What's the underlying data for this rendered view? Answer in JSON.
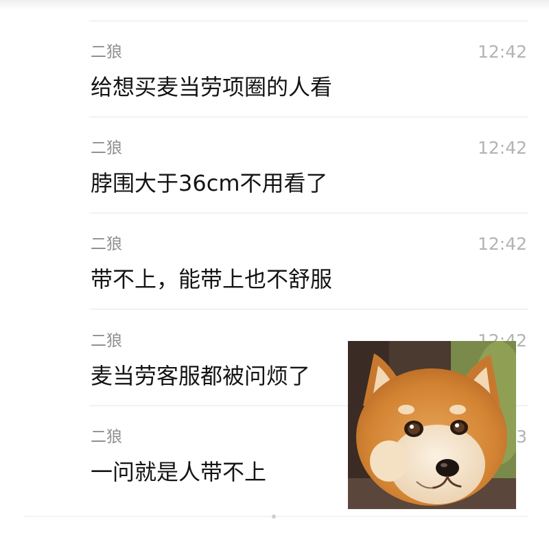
{
  "messages": [
    {
      "sender": "二狼",
      "time": "12:42",
      "text": "给想买麦当劳项圈的人看"
    },
    {
      "sender": "二狼",
      "time": "12:42",
      "text": "脖围大于36cm不用看了"
    },
    {
      "sender": "二狼",
      "time": "12:42",
      "text": "带不上，能带上也不舒服"
    },
    {
      "sender": "二狼",
      "time": "12:42",
      "text": "麦当劳客服都被问烦了"
    },
    {
      "sender": "二狼",
      "time": "12:43",
      "text": "一问就是人带不上"
    }
  ],
  "sticker": {
    "subject": "shiba-inu-dog-meme",
    "icon": "dog-face-icon"
  },
  "colors": {
    "sender": "#8f8f8f",
    "time": "#b3b3b3",
    "text": "#141414",
    "divider": "#e6e6e6",
    "fur": "#d98b3c"
  }
}
